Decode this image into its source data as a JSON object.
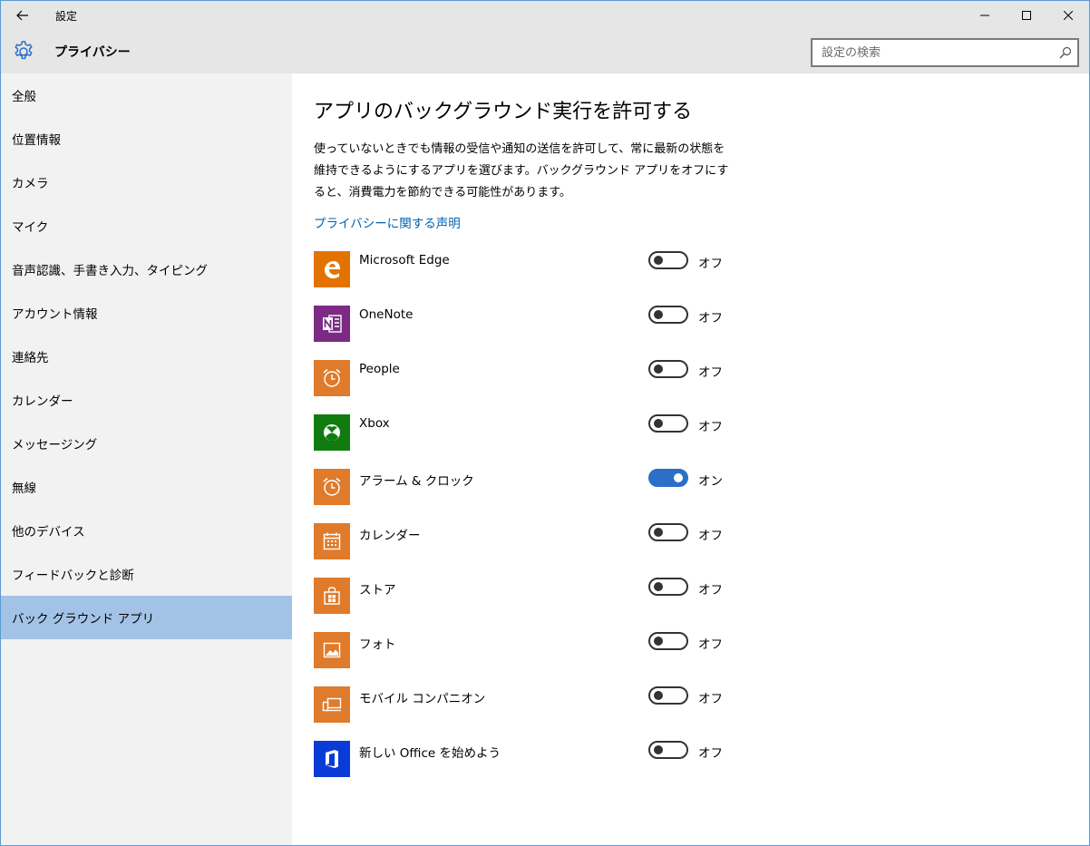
{
  "titlebar": {
    "title": "設定"
  },
  "header": {
    "title": "プライバシー"
  },
  "search": {
    "placeholder": "設定の検索"
  },
  "sidebar": {
    "items": [
      {
        "label": "全般"
      },
      {
        "label": "位置情報"
      },
      {
        "label": "カメラ"
      },
      {
        "label": "マイク"
      },
      {
        "label": "音声認識、手書き入力、タイピング"
      },
      {
        "label": "アカウント情報"
      },
      {
        "label": "連絡先"
      },
      {
        "label": "カレンダー"
      },
      {
        "label": "メッセージング"
      },
      {
        "label": "無線"
      },
      {
        "label": "他のデバイス"
      },
      {
        "label": "フィードバックと診断"
      },
      {
        "label": "バック グラウンド アプリ"
      }
    ]
  },
  "main": {
    "title": "アプリのバックグラウンド実行を許可する",
    "description": "使っていないときでも情報の受信や通知の送信を許可して、常に最新の状態を維持できるようにするアプリを選びます。バックグラウンド アプリをオフにすると、消費電力を節約できる可能性があります。",
    "privacy_link": "プライバシーに関する声明",
    "apps": [
      {
        "name": "Microsoft Edge",
        "state": "オフ",
        "on": false,
        "icon": "edge-icon",
        "color": "#e37300"
      },
      {
        "name": "OneNote",
        "state": "オフ",
        "on": false,
        "icon": "onenote-icon",
        "color": "#7b2b83"
      },
      {
        "name": "People",
        "state": "オフ",
        "on": false,
        "icon": "alarm-clock-icon",
        "color": "#e07b2b"
      },
      {
        "name": "Xbox",
        "state": "オフ",
        "on": false,
        "icon": "xbox-icon",
        "color": "#107c10"
      },
      {
        "name": "アラーム & クロック",
        "state": "オン",
        "on": true,
        "icon": "alarm-clock-icon",
        "color": "#e07b2b"
      },
      {
        "name": "カレンダー",
        "state": "オフ",
        "on": false,
        "icon": "calendar-icon",
        "color": "#e07b2b"
      },
      {
        "name": "ストア",
        "state": "オフ",
        "on": false,
        "icon": "store-icon",
        "color": "#e07b2b"
      },
      {
        "name": "フォト",
        "state": "オフ",
        "on": false,
        "icon": "photo-icon",
        "color": "#e07b2b"
      },
      {
        "name": "モバイル コンパニオン",
        "state": "オフ",
        "on": false,
        "icon": "phone-companion-icon",
        "color": "#e07b2b"
      },
      {
        "name": "新しい Office を始めよう",
        "state": "オフ",
        "on": false,
        "icon": "office-icon",
        "color": "#0b3bd6"
      }
    ]
  },
  "colors": {
    "accent": "#2b6fc7",
    "link": "#0063b1",
    "active_item": "#a3c3e6"
  }
}
